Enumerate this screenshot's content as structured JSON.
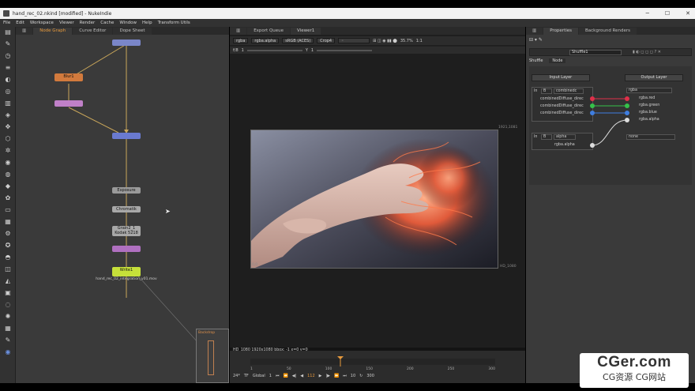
{
  "window": {
    "title": "hand_rec_02.nkind [modified] - NukeIndie",
    "min": "─",
    "max": "☐",
    "close": "✕"
  },
  "menu": [
    "File",
    "Edit",
    "Workspace",
    "Viewer",
    "Render",
    "Cache",
    "Window",
    "Help",
    "Transform Utils"
  ],
  "graph": {
    "tabs": [
      "Node Graph",
      "Curve Editor",
      "Dope Sheet"
    ],
    "nodes": {
      "blur": "Blur1",
      "grade": "Exposure",
      "chroma": "Chromatik",
      "grain": "Grain2_1",
      "grain_sub": "Kodak 5218",
      "write": "Write1",
      "write_path": "hand_rec_02_integration_v01.mov",
      "backdrop": "Backdrop"
    }
  },
  "viewer": {
    "tabs": [
      "Export Queue",
      "Viewer1"
    ],
    "channel": "rgba",
    "channel2": "rgba.alpha",
    "colorspace": "sRGB (ACES)",
    "crop": "Crop4",
    "zoom": "35.7%",
    "ratio": "1:1",
    "gain": "f/8",
    "gain_val": "1",
    "gamma_label": "Y",
    "gamma_val": "1",
    "frame_top": "1921,1081",
    "frame_right": "HD_1080",
    "frame_corner": "0,0",
    "info": "HD_1080 1920x1080  bbox: -1  x=0 y=0",
    "fps": "24*",
    "tf": "TF",
    "global": "Global",
    "cur_frame": "112",
    "in_frame": "1",
    "out_frame": "300",
    "step": "10",
    "ticks": [
      "1",
      "50",
      "100",
      "150",
      "200",
      "250",
      "300"
    ]
  },
  "props": {
    "tabs": [
      "Properties",
      "Background Renders"
    ],
    "node_name": "Shuffle1",
    "subtabs": [
      "Shuffle",
      "Node"
    ],
    "input_layer": "Input Layer",
    "output_layer": "Output Layer",
    "in1": "In",
    "in1_sel": "B",
    "in1_layer": "combinedc",
    "out_layer": "rgba",
    "rows_in": [
      "combinedDiffuse_direc",
      "combinedDiffuse_direc",
      "combinedDiffuse_direc"
    ],
    "rows_out": [
      "rgba.red",
      "rgba.green",
      "rgba.blue",
      "rgba.alpha"
    ],
    "in2": "In",
    "in2_sel": "B",
    "in2_layer": "alpha",
    "in2_row": "rgba.alpha",
    "out2": "none",
    "colors": {
      "red": "#e0304a",
      "green": "#35c04a",
      "blue": "#3f7ee0",
      "white": "#dddddd"
    }
  },
  "watermark": {
    "brand": "CGer.com",
    "sub": "CG资源 CG网站"
  }
}
